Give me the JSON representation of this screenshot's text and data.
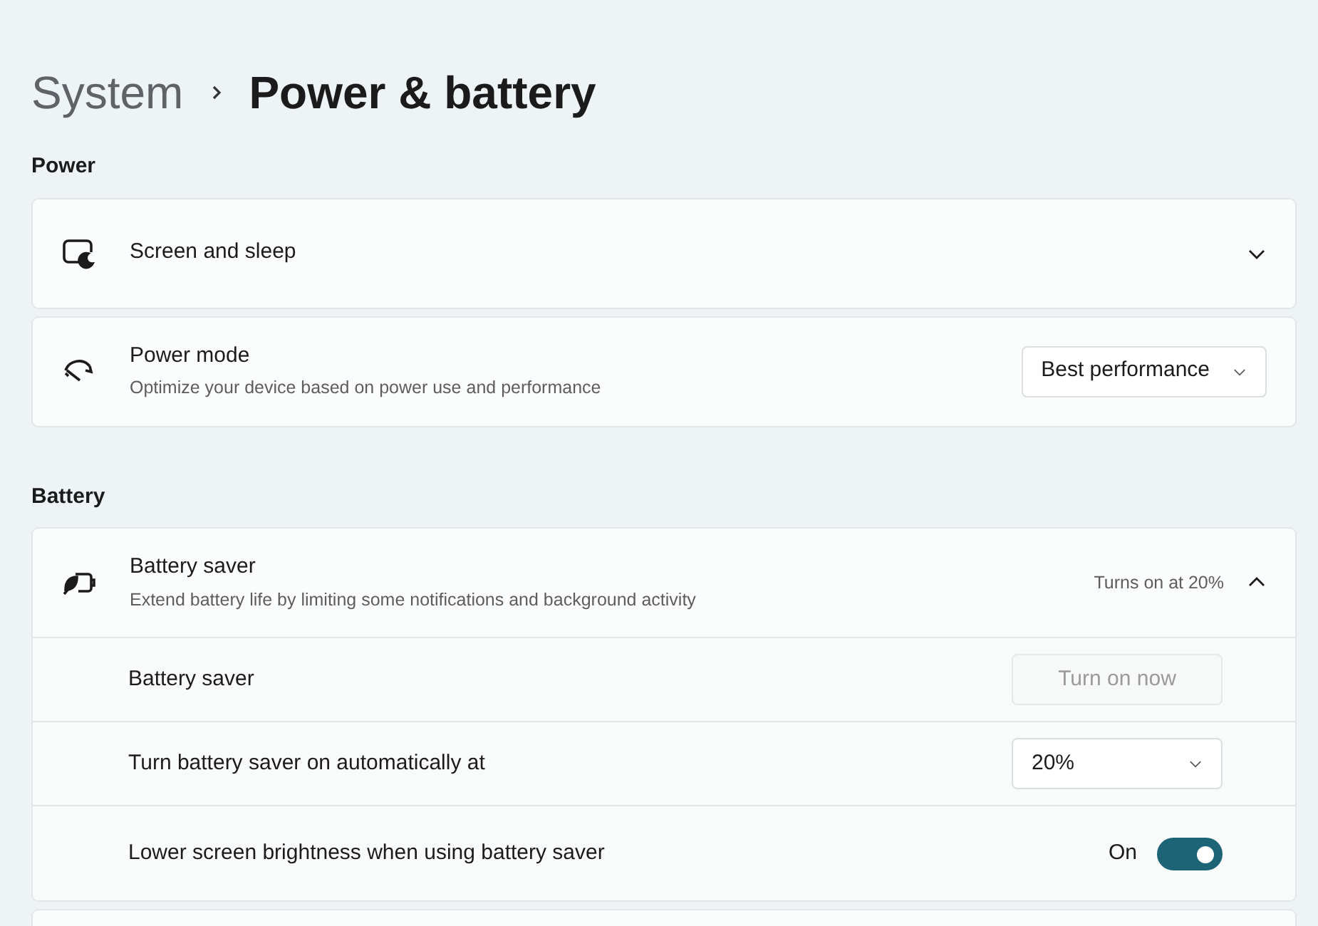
{
  "breadcrumb": {
    "parent": "System",
    "current": "Power & battery"
  },
  "sections": [
    {
      "title": "Power",
      "cards": [
        {
          "kind": "expander",
          "title": "Screen and sleep",
          "expanded": false
        },
        {
          "kind": "dropdown",
          "title": "Power mode",
          "description": "Optimize your device based on power use and performance",
          "value": "Best performance"
        }
      ]
    },
    {
      "title": "Battery",
      "cards": [
        {
          "kind": "expander",
          "title": "Battery saver",
          "description": "Extend battery life by limiting some notifications and background activity",
          "status": "Turns on at 20%",
          "expanded": true,
          "children": [
            {
              "kind": "button",
              "label": "Battery saver",
              "button": "Turn on now",
              "disabled": true
            },
            {
              "kind": "dropdown",
              "label": "Turn battery saver on automatically at",
              "value": "20%"
            },
            {
              "kind": "toggle",
              "label": "Lower screen brightness when using battery saver",
              "state_text": "On",
              "on": true
            }
          ]
        }
      ]
    }
  ]
}
